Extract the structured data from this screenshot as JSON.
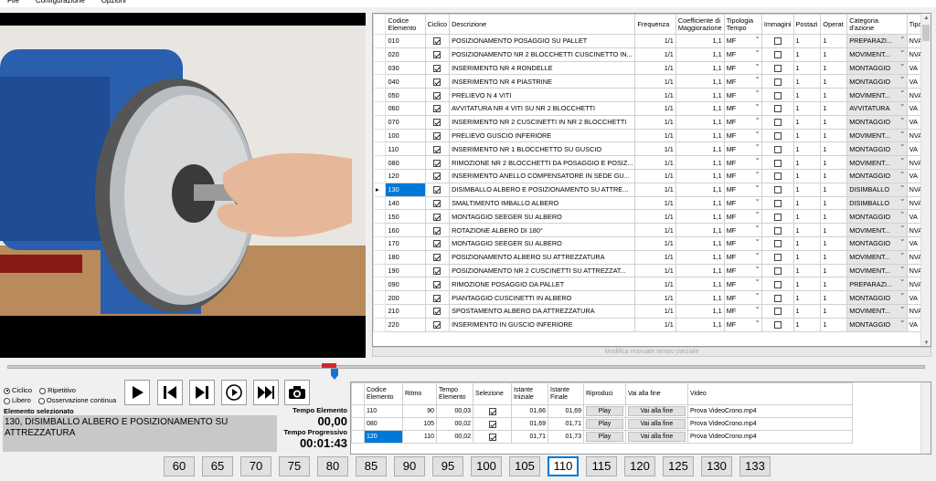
{
  "menu": [
    "File",
    "Configurazione",
    "Opzioni"
  ],
  "grid": {
    "columns": [
      "Codice Elemento",
      "Ciclico",
      "Descrizione",
      "Frequenza",
      "Coefficiente di Maggiorazione",
      "Tipologia Tempo",
      "Immagini",
      "Postazi",
      "Operat",
      "Categoria d'azione",
      "Tipo"
    ],
    "rows": [
      {
        "code": "010",
        "ciclico": true,
        "desc": "POSIZIONAMENTO POSAGGIO SU PALLET",
        "freq": "1/1",
        "coef": "1,1",
        "tipo_tempo": "MF",
        "imm": false,
        "post": "1",
        "oper": "1",
        "cat": "PREPARAZI...",
        "tipo": "NVA"
      },
      {
        "code": "020",
        "ciclico": true,
        "desc": "POSIZIONAMENTO NR 2 BLOCCHETTI CUSCINETTO IN...",
        "freq": "1/1",
        "coef": "1,1",
        "tipo_tempo": "MF",
        "imm": false,
        "post": "1",
        "oper": "1",
        "cat": "MOVIMENT...",
        "tipo": "NVA"
      },
      {
        "code": "030",
        "ciclico": true,
        "desc": "INSERIMENTO NR 4 RONDELLE",
        "freq": "1/1",
        "coef": "1,1",
        "tipo_tempo": "MF",
        "imm": false,
        "post": "1",
        "oper": "1",
        "cat": "MONTAGGIO",
        "tipo": "VA"
      },
      {
        "code": "040",
        "ciclico": true,
        "desc": "INSERIMENTO NR 4 PIASTRINE",
        "freq": "1/1",
        "coef": "1,1",
        "tipo_tempo": "MF",
        "imm": false,
        "post": "1",
        "oper": "1",
        "cat": "MONTAGGIO",
        "tipo": "VA"
      },
      {
        "code": "050",
        "ciclico": true,
        "desc": "PRELIEVO N 4 VITI",
        "freq": "1/1",
        "coef": "1,1",
        "tipo_tempo": "MF",
        "imm": false,
        "post": "1",
        "oper": "1",
        "cat": "MOVIMENT...",
        "tipo": "NVA"
      },
      {
        "code": "060",
        "ciclico": true,
        "desc": "AVVITATURA NR 4 VITI SU NR 2 BLOCCHETTI",
        "freq": "1/1",
        "coef": "1,1",
        "tipo_tempo": "MF",
        "imm": false,
        "post": "1",
        "oper": "1",
        "cat": "AVVITATURA",
        "tipo": "VA"
      },
      {
        "code": "070",
        "ciclico": true,
        "desc": "INSERIMENTO NR 2 CUSCINETTI IN NR 2 BLOCCHETTI",
        "freq": "1/1",
        "coef": "1,1",
        "tipo_tempo": "MF",
        "imm": false,
        "post": "1",
        "oper": "1",
        "cat": "MONTAGGIO",
        "tipo": "VA"
      },
      {
        "code": "100",
        "ciclico": true,
        "desc": "PRELIEVO GUSCIO INFERIORE",
        "freq": "1/1",
        "coef": "1,1",
        "tipo_tempo": "MF",
        "imm": false,
        "post": "1",
        "oper": "1",
        "cat": "MOVIMENT...",
        "tipo": "NVA"
      },
      {
        "code": "110",
        "ciclico": true,
        "desc": "INSERIMENTO NR 1 BLOCCHETTO SU GUSCIO",
        "freq": "1/1",
        "coef": "1,1",
        "tipo_tempo": "MF",
        "imm": false,
        "post": "1",
        "oper": "1",
        "cat": "MONTAGGIO",
        "tipo": "VA"
      },
      {
        "code": "080",
        "ciclico": true,
        "desc": "RIMOZIONE NR 2 BLOCCHETTI DA POSAGGIO E POSIZ...",
        "freq": "1/1",
        "coef": "1,1",
        "tipo_tempo": "MF",
        "imm": false,
        "post": "1",
        "oper": "1",
        "cat": "MOVIMENT...",
        "tipo": "NVA"
      },
      {
        "code": "120",
        "ciclico": true,
        "desc": "INSERIMENTO ANELLO COMPENSATORE IN SEDE GU...",
        "freq": "1/1",
        "coef": "1,1",
        "tipo_tempo": "MF",
        "imm": false,
        "post": "1",
        "oper": "1",
        "cat": "MONTAGGIO",
        "tipo": "VA"
      },
      {
        "code": "130",
        "ciclico": true,
        "desc": "DISIMBALLO ALBERO E POSIZIONAMENTO SU ATTRE...",
        "freq": "1/1",
        "coef": "1,1",
        "tipo_tempo": "MF",
        "imm": false,
        "post": "1",
        "oper": "1",
        "cat": "DISIMBALLO",
        "tipo": "NVA",
        "selected": true
      },
      {
        "code": "140",
        "ciclico": true,
        "desc": "SMALTIMENTO IMBALLO ALBERO",
        "freq": "1/1",
        "coef": "1,1",
        "tipo_tempo": "MF",
        "imm": false,
        "post": "1",
        "oper": "1",
        "cat": "DISIMBALLO",
        "tipo": "NVA"
      },
      {
        "code": "150",
        "ciclico": true,
        "desc": "MONTAGGIO SEEGER SU ALBERO",
        "freq": "1/1",
        "coef": "1,1",
        "tipo_tempo": "MF",
        "imm": false,
        "post": "1",
        "oper": "1",
        "cat": "MONTAGGIO",
        "tipo": "VA"
      },
      {
        "code": "160",
        "ciclico": true,
        "desc": "ROTAZIONE ALBERO DI 180°",
        "freq": "1/1",
        "coef": "1,1",
        "tipo_tempo": "MF",
        "imm": false,
        "post": "1",
        "oper": "1",
        "cat": "MOVIMENT...",
        "tipo": "NVA"
      },
      {
        "code": "170",
        "ciclico": true,
        "desc": "MONTAGGIO SEEGER SU ALBERO",
        "freq": "1/1",
        "coef": "1,1",
        "tipo_tempo": "MF",
        "imm": false,
        "post": "1",
        "oper": "1",
        "cat": "MONTAGGIO",
        "tipo": "VA"
      },
      {
        "code": "180",
        "ciclico": true,
        "desc": "POSIZIONAMENTO ALBERO SU ATTREZZATURA",
        "freq": "1/1",
        "coef": "1,1",
        "tipo_tempo": "MF",
        "imm": false,
        "post": "1",
        "oper": "1",
        "cat": "MOVIMENT...",
        "tipo": "NVA"
      },
      {
        "code": "190",
        "ciclico": true,
        "desc": "POSIZIONAMENTO NR 2 CUSCINETTI SU ATTREZZAT...",
        "freq": "1/1",
        "coef": "1,1",
        "tipo_tempo": "MF",
        "imm": false,
        "post": "1",
        "oper": "1",
        "cat": "MOVIMENT...",
        "tipo": "NVA"
      },
      {
        "code": "090",
        "ciclico": true,
        "desc": "RIMOZIONE POSAGGIO DA PALLET",
        "freq": "1/1",
        "coef": "1,1",
        "tipo_tempo": "MF",
        "imm": false,
        "post": "1",
        "oper": "1",
        "cat": "PREPARAZI...",
        "tipo": "NVA"
      },
      {
        "code": "200",
        "ciclico": true,
        "desc": "PIANTAGGIO CUSCINETTI IN ALBERO",
        "freq": "1/1",
        "coef": "1,1",
        "tipo_tempo": "MF",
        "imm": false,
        "post": "1",
        "oper": "1",
        "cat": "MONTAGGIO",
        "tipo": "VA"
      },
      {
        "code": "210",
        "ciclico": true,
        "desc": "SPOSTAMENTO ALBERO DA ATTREZZATURA",
        "freq": "1/1",
        "coef": "1,1",
        "tipo_tempo": "MF",
        "imm": false,
        "post": "1",
        "oper": "1",
        "cat": "MOVIMENT...",
        "tipo": "NVA"
      },
      {
        "code": "220",
        "ciclico": true,
        "desc": "INSERIMENTO IN GUSCIO INFERIORE",
        "freq": "1/1",
        "coef": "1,1",
        "tipo_tempo": "MF",
        "imm": false,
        "post": "1",
        "oper": "1",
        "cat": "MONTAGGIO",
        "tipo": "VA"
      }
    ]
  },
  "hscroll_text": "Modifica manuale tempo parziale",
  "modes": {
    "ciclico": "Ciclico",
    "ripetitivo": "Ripetitivo",
    "libero": "Libero",
    "osservazione": "Osservazione continua"
  },
  "selected": {
    "label": "Elemento selezionato",
    "text": "130, DISIMBALLO ALBERO E POSIZIONAMENTO SU ATTREZZATURA"
  },
  "times": {
    "elemento_label": "Tempo Elemento",
    "elemento_value": "00,00",
    "progressivo_label": "Tempo Progressivo",
    "progressivo_value": "00:01:43"
  },
  "sub": {
    "columns": [
      "Codice Elemento",
      "Ritmo",
      "Tempo Elemento",
      "Selezione",
      "Istante Iniziale",
      "Istante Finale",
      "Riproduci",
      "Vai alla fine",
      "Video"
    ],
    "rows": [
      {
        "code": "110",
        "ritmo": "90",
        "tempo": "00,03",
        "sel": true,
        "ini": "01,66",
        "fin": "01,69",
        "play": "Play",
        "fine": "Vai alla fine",
        "video": "Prova VideoCrono.mp4"
      },
      {
        "code": "080",
        "ritmo": "105",
        "tempo": "00,02",
        "sel": true,
        "ini": "01,69",
        "fin": "01,71",
        "play": "Play",
        "fine": "Vai alla fine",
        "video": "Prova VideoCrono.mp4"
      },
      {
        "code": "120",
        "ritmo": "110",
        "tempo": "00,02",
        "sel": true,
        "ini": "01,71",
        "fin": "01,73",
        "play": "Play",
        "fine": "Vai alla fine",
        "video": "Prova VideoCrono.mp4",
        "selected": true
      }
    ]
  },
  "rates": [
    "60",
    "65",
    "70",
    "75",
    "80",
    "85",
    "90",
    "95",
    "100",
    "105",
    "110",
    "115",
    "120",
    "125",
    "130",
    "133"
  ],
  "active_rate": "110",
  "icons": [
    "play-icon",
    "skip-back-icon",
    "skip-forward-icon",
    "circle-play-icon",
    "fast-forward-icon",
    "camera-icon"
  ]
}
